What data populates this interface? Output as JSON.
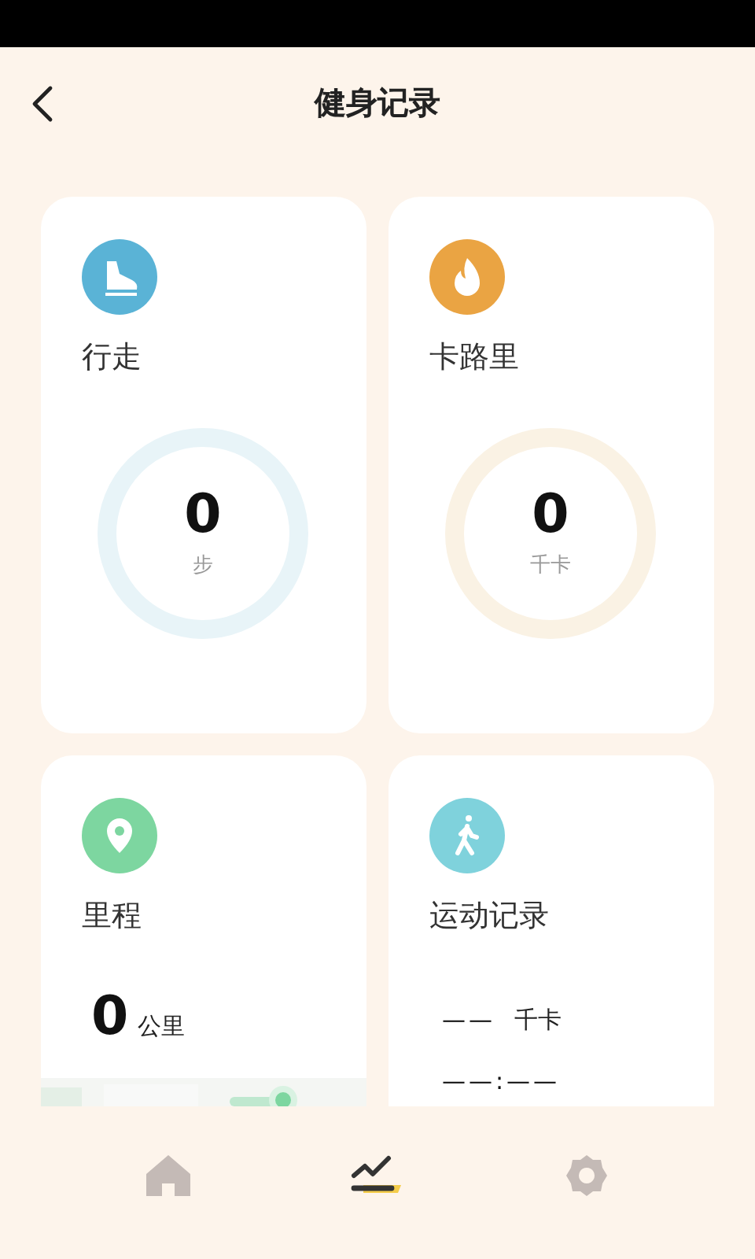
{
  "header": {
    "title": "健身记录"
  },
  "cards": [
    {
      "kind": "steps",
      "color": "#5ab3d6",
      "title": "行走",
      "value": "0",
      "unit": "步"
    },
    {
      "kind": "calories",
      "color": "#eaa443",
      "title": "卡路里",
      "value": "0",
      "unit": "千卡"
    },
    {
      "kind": "distance",
      "color": "#7dd6a0",
      "title": "里程",
      "value": "0",
      "unit": "公里"
    },
    {
      "kind": "record",
      "color": "#7fd2dc",
      "title": "运动记录",
      "value": "——",
      "unit": "千卡",
      "time": "——:——"
    }
  ],
  "nav": [
    {
      "kind": "home",
      "selected": false
    },
    {
      "kind": "chart",
      "selected": true
    },
    {
      "kind": "settings",
      "selected": false
    }
  ]
}
